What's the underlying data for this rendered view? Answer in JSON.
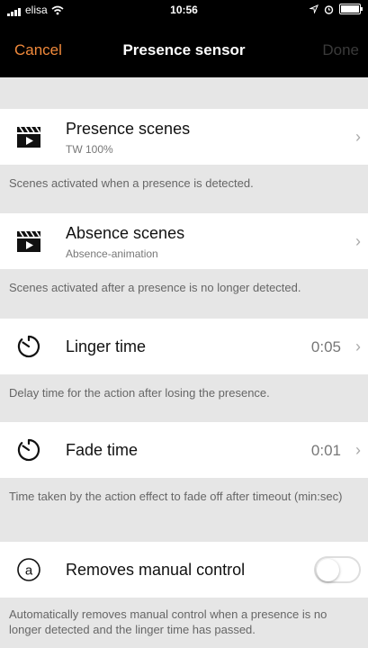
{
  "status_bar": {
    "carrier": "elisa",
    "time": "10:56"
  },
  "nav": {
    "cancel": "Cancel",
    "title": "Presence sensor",
    "done": "Done"
  },
  "rows": {
    "presence": {
      "label": "Presence scenes",
      "sub": "TW 100%",
      "desc": "Scenes activated when a presence is detected."
    },
    "absence": {
      "label": "Absence scenes",
      "sub": "Absence-animation",
      "desc": "Scenes activated after a presence is no longer detected."
    },
    "linger": {
      "label": "Linger time",
      "value": "0:05",
      "desc": "Delay time for the action after losing the presence."
    },
    "fade": {
      "label": "Fade time",
      "value": "0:01",
      "desc": "Time taken by the action effect to fade off after timeout (min:sec)"
    },
    "manual": {
      "label": "Removes manual control",
      "toggle_on": false,
      "desc": "Automatically removes manual control when a presence is no longer detected and the linger time has passed."
    }
  },
  "icons": {
    "scene": "clapperboard-icon",
    "timer": "timer-icon",
    "auto": "circled-a-icon"
  },
  "colors": {
    "accent": "#f0893b",
    "navbar": "#000000",
    "background": "#e6e6e6"
  }
}
